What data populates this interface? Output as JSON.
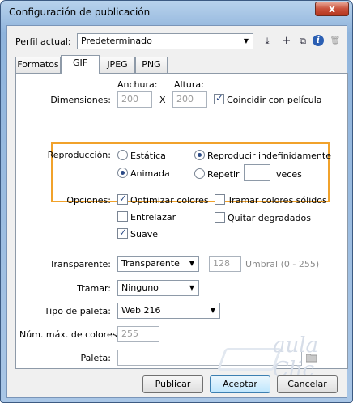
{
  "window": {
    "title": "Configuración de publicación",
    "close_glyph": "x"
  },
  "profile": {
    "label": "Perfil actual:",
    "value": "Predeterminado",
    "tools": [
      {
        "icon": "import-export-icon",
        "glyph": "⤓"
      },
      {
        "icon": "add-icon",
        "glyph": "+"
      },
      {
        "icon": "duplicate-icon",
        "glyph": "⧉"
      },
      {
        "icon": "info-icon",
        "glyph": "i"
      },
      {
        "icon": "delete-icon",
        "glyph": "🗑"
      }
    ]
  },
  "tabs": [
    "Formatos",
    "GIF",
    "JPEG",
    "PNG"
  ],
  "active_tab": "GIF",
  "dimensions": {
    "label": "Dimensiones:",
    "width_label": "Anchura:",
    "height_label": "Altura:",
    "width": "200",
    "height": "200",
    "times": "X",
    "match_movie": "Coincidir con película"
  },
  "playback": {
    "label": "Reproducción:",
    "static": "Estática",
    "animated": "Animada",
    "loop": "Reproducir indefinidamente",
    "repeat": "Repetir",
    "repeat_value": "",
    "times_label": "veces"
  },
  "options": {
    "label": "Opciones:",
    "optimize": "Optimizar colores",
    "interlace": "Entrelazar",
    "smooth": "Suave",
    "dither_solids": "Tramar colores sólidos",
    "remove_gradients": "Quitar degradados"
  },
  "transparent": {
    "label": "Transparente:",
    "value": "Transparente",
    "threshold": "128",
    "threshold_hint": "Umbral (0 - 255)"
  },
  "dither": {
    "label": "Tramar:",
    "value": "Ninguno"
  },
  "palette_type": {
    "label": "Tipo de paleta:",
    "value": "Web 216"
  },
  "max_colors": {
    "label": "Núm. máx. de colores:",
    "value": "255"
  },
  "palette": {
    "label": "Paleta:",
    "value": ""
  },
  "buttons": {
    "publish": "Publicar",
    "ok": "Aceptar",
    "cancel": "Cancelar"
  },
  "watermark": {
    "text": "aula Clic"
  },
  "colors": {
    "highlight": "#f1a22b",
    "accent": "#2b4a86"
  }
}
